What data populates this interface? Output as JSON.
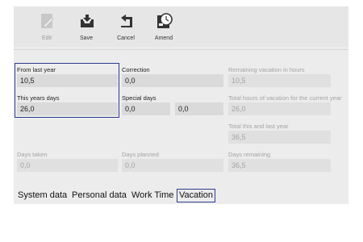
{
  "toolbar": {
    "buttons": [
      {
        "label": "Edit",
        "icon": "pencil-icon",
        "enabled": false
      },
      {
        "label": "Save",
        "icon": "save-tray-icon",
        "enabled": true
      },
      {
        "label": "Cancel",
        "icon": "undo-arrow-icon",
        "enabled": true
      },
      {
        "label": "Amend",
        "icon": "clock-pencil-icon",
        "enabled": true
      }
    ]
  },
  "form": {
    "from_last_year": {
      "label": "From last year",
      "value": "10,5"
    },
    "this_years_days": {
      "label": "This years days",
      "value": "26,0"
    },
    "correction": {
      "label": "Correction",
      "value": "0,0"
    },
    "special_days": {
      "label": "Special days",
      "value_1": "0,0",
      "value_2": "0,0"
    },
    "remaining_hours": {
      "label": "Remaining vacation in hours",
      "value": "10,5"
    },
    "total_hours_current": {
      "label": "Total hours of vacation for the current year",
      "value": "26,0"
    },
    "total_this_last": {
      "label": "Total this and last year",
      "value": "36,5"
    },
    "days_taken": {
      "label": "Days taken",
      "value": "0,0"
    },
    "days_planned": {
      "label": "Days planned",
      "value": "0,0"
    },
    "days_remaining": {
      "label": "Days remaining",
      "value": "36,5"
    }
  },
  "tabs": [
    {
      "label": "System data",
      "active": false
    },
    {
      "label": "Personal data",
      "active": false
    },
    {
      "label": "Work Time",
      "active": false
    },
    {
      "label": "Vacation",
      "active": true
    }
  ],
  "colors": {
    "highlight_border": "#2f3c8f",
    "field_bg": "#dadada",
    "disabled_text": "#a4a4a4"
  }
}
